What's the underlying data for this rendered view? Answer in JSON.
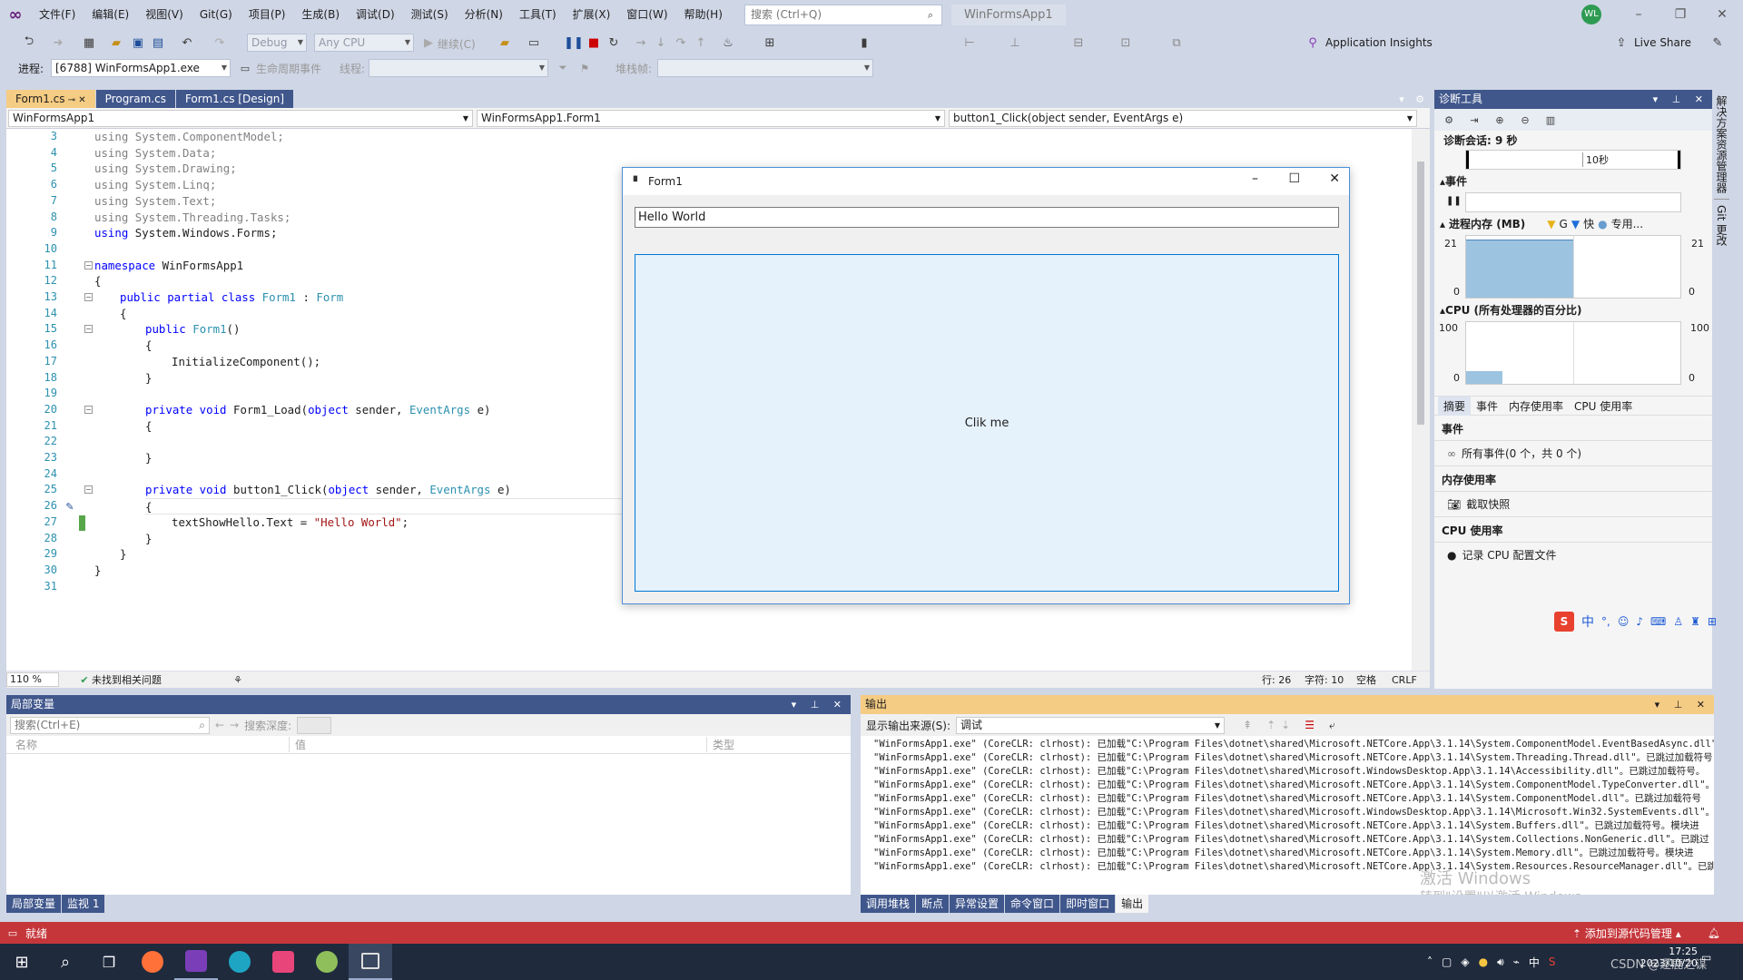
{
  "menu": {
    "items": [
      "文件(F)",
      "编辑(E)",
      "视图(V)",
      "Git(G)",
      "项目(P)",
      "生成(B)",
      "调试(D)",
      "测试(S)",
      "分析(N)",
      "工具(T)",
      "扩展(X)",
      "窗口(W)",
      "帮助(H)"
    ],
    "search_placeholder": "搜索 (Ctrl+Q)",
    "app_name": "WinFormsApp1",
    "avatar_text": "WL"
  },
  "toolbar": {
    "config": "Debug",
    "platform": "Any CPU",
    "continue": "继续(C)",
    "app_insights": "Application Insights",
    "live_share": "Live Share"
  },
  "toolbar2": {
    "process_label": "进程:",
    "process_value": "[6788] WinFormsApp1.exe",
    "lifecycle": "生命周期事件",
    "thread_label": "线程:",
    "stack_label": "堆栈帧:"
  },
  "doc_tabs": [
    "Form1.cs",
    "Program.cs",
    "Form1.cs [Design]"
  ],
  "nav": {
    "project": "WinFormsApp1",
    "class": "WinFormsApp1.Form1",
    "member": "button1_Click(object sender, EventArgs e)"
  },
  "code": {
    "line_numbers": [
      "3",
      "4",
      "5",
      "6",
      "7",
      "8",
      "9",
      "10",
      "11",
      "12",
      "13",
      "14",
      "15",
      "16",
      "17",
      "18",
      "19",
      "20",
      "21",
      "22",
      "23",
      "24",
      "25",
      "26",
      "27",
      "28",
      "29",
      "30",
      "31"
    ]
  },
  "editor_status": {
    "zoom": "110 %",
    "issues": "未找到相关问题",
    "line": "行: 26",
    "char": "字符: 10",
    "space": "空格",
    "crlf": "CRLF"
  },
  "form": {
    "title": "Form1",
    "textbox_value": "Hello World",
    "button_label": "Clik me"
  },
  "diag": {
    "title": "诊断工具",
    "session": "诊断会话: 9 秒",
    "timeline": "10秒",
    "events": "事件",
    "memory": "进程内存 (MB)",
    "mem_legend": [
      "G",
      "快",
      "专用..."
    ],
    "mem_max": "21",
    "mem_min": "0",
    "cpu": "CPU (所有处理器的百分比)",
    "cpu_max": "100",
    "cpu_min": "0",
    "tabs": [
      "摘要",
      "事件",
      "内存使用率",
      "CPU 使用率"
    ],
    "sec_events": "事件",
    "all_events": "所有事件(0 个，共 0 个)",
    "sec_memory": "内存使用率",
    "snapshot": "截取快照",
    "sec_cpu": "CPU 使用率",
    "record_cpu": "记录 CPU 配置文件"
  },
  "side_tabs": [
    "解决方案资源管理器",
    "Git 更改"
  ],
  "locals": {
    "title": "局部变量",
    "search": "搜索(Ctrl+E)",
    "depth": "搜索深度:",
    "cols": [
      "名称",
      "值",
      "类型"
    ],
    "tabs": [
      "局部变量",
      "监视 1"
    ]
  },
  "output": {
    "title": "输出",
    "source_label": "显示输出来源(S):",
    "source_value": "调试",
    "lines": [
      "\"WinFormsApp1.exe\" (CoreCLR: clrhost): 已加载\"C:\\Program Files\\dotnet\\shared\\Microsoft.NETCore.App\\3.1.14\\System.ComponentModel.EventBasedAsync.dll\"",
      "\"WinFormsApp1.exe\" (CoreCLR: clrhost): 已加载\"C:\\Program Files\\dotnet\\shared\\Microsoft.NETCore.App\\3.1.14\\System.Threading.Thread.dll\"。已跳过加载符号",
      "\"WinFormsApp1.exe\" (CoreCLR: clrhost): 已加载\"C:\\Program Files\\dotnet\\shared\\Microsoft.WindowsDesktop.App\\3.1.14\\Accessibility.dll\"。已跳过加载符号。",
      "\"WinFormsApp1.exe\" (CoreCLR: clrhost): 已加载\"C:\\Program Files\\dotnet\\shared\\Microsoft.NETCore.App\\3.1.14\\System.ComponentModel.TypeConverter.dll\"。i",
      "\"WinFormsApp1.exe\" (CoreCLR: clrhost): 已加载\"C:\\Program Files\\dotnet\\shared\\Microsoft.NETCore.App\\3.1.14\\System.ComponentModel.dll\"。已跳过加载符号",
      "\"WinFormsApp1.exe\" (CoreCLR: clrhost): 已加载\"C:\\Program Files\\dotnet\\shared\\Microsoft.WindowsDesktop.App\\3.1.14\\Microsoft.Win32.SystemEvents.dll\"。模块进",
      "\"WinFormsApp1.exe\" (CoreCLR: clrhost): 已加载\"C:\\Program Files\\dotnet\\shared\\Microsoft.NETCore.App\\3.1.14\\System.Buffers.dll\"。已跳过加载符号。模块进",
      "\"WinFormsApp1.exe\" (CoreCLR: clrhost): 已加载\"C:\\Program Files\\dotnet\\shared\\Microsoft.NETCore.App\\3.1.14\\System.Collections.NonGeneric.dll\"。已跳过",
      "\"WinFormsApp1.exe\" (CoreCLR: clrhost): 已加载\"C:\\Program Files\\dotnet\\shared\\Microsoft.NETCore.App\\3.1.14\\System.Memory.dll\"。已跳过加载符号。模块进",
      "\"WinFormsApp1.exe\" (CoreCLR: clrhost): 已加载\"C:\\Program Files\\dotnet\\shared\\Microsoft.NETCore.App\\3.1.14\\System.Resources.ResourceManager.dll\"。已跳"
    ],
    "tabs": [
      "调用堆栈",
      "断点",
      "异常设置",
      "命令窗口",
      "即时窗口",
      "输出"
    ],
    "watermark1": "激活 Windows",
    "watermark2": "转到\"设置\"以激活 Windows。"
  },
  "status": {
    "ready": "就绪",
    "source_control": "添加到源代码管理"
  },
  "taskbar": {
    "time": "17:25",
    "date": "2023/10/20",
    "ime": "中",
    "csdn": "CSDN @逐鹿之谋"
  }
}
